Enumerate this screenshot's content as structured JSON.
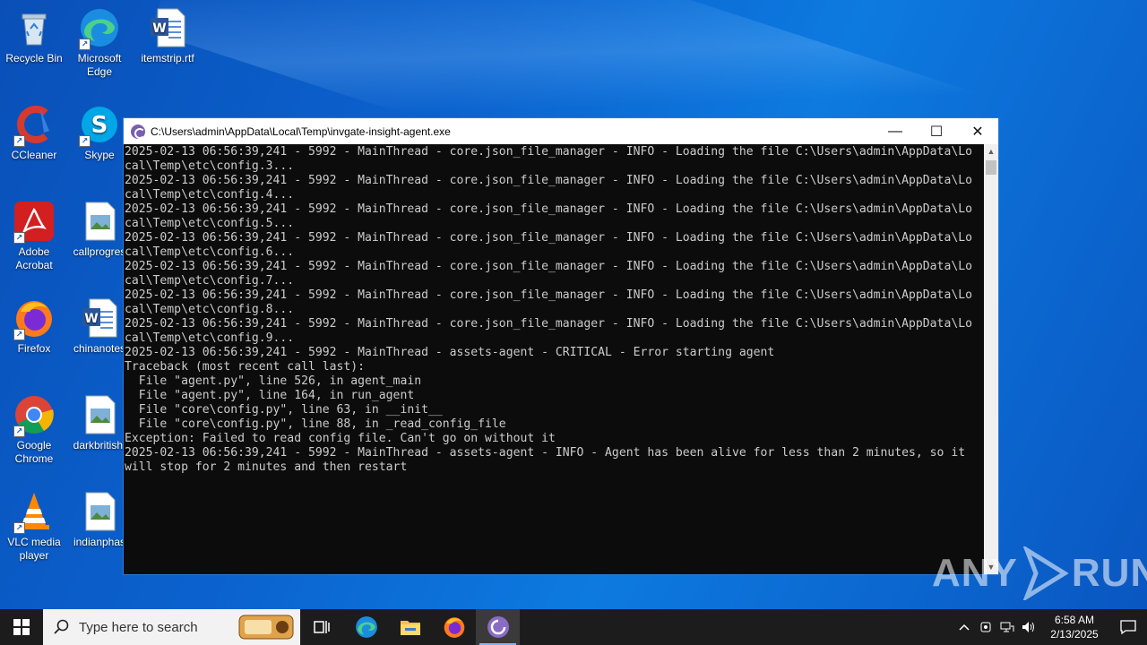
{
  "desktop": {
    "icons": [
      {
        "label": "Recycle Bin"
      },
      {
        "label": "Microsoft Edge"
      },
      {
        "label": "itemstrip.rtf"
      },
      {
        "label": "CCleaner"
      },
      {
        "label": "Skype"
      },
      {
        "label": "Adobe Acrobat"
      },
      {
        "label": "callprogres"
      },
      {
        "label": "Firefox"
      },
      {
        "label": "chinanotes"
      },
      {
        "label": "Google Chrome"
      },
      {
        "label": "darkbritish."
      },
      {
        "label": "VLC media player"
      },
      {
        "label": "indianphas"
      }
    ]
  },
  "window": {
    "title": "C:\\Users\\admin\\AppData\\Local\\Temp\\invgate-insight-agent.exe",
    "minimize_glyph": "—",
    "maximize_glyph": "☐",
    "close_glyph": "✕",
    "console_lines": [
      "2025-02-13 06:56:39,241 - 5992 - MainThread - core.json_file_manager - INFO - Loading the file C:\\Users\\admin\\AppData\\Lo",
      "cal\\Temp\\etc\\config.3...",
      "2025-02-13 06:56:39,241 - 5992 - MainThread - core.json_file_manager - INFO - Loading the file C:\\Users\\admin\\AppData\\Lo",
      "cal\\Temp\\etc\\config.4...",
      "2025-02-13 06:56:39,241 - 5992 - MainThread - core.json_file_manager - INFO - Loading the file C:\\Users\\admin\\AppData\\Lo",
      "cal\\Temp\\etc\\config.5...",
      "2025-02-13 06:56:39,241 - 5992 - MainThread - core.json_file_manager - INFO - Loading the file C:\\Users\\admin\\AppData\\Lo",
      "cal\\Temp\\etc\\config.6...",
      "2025-02-13 06:56:39,241 - 5992 - MainThread - core.json_file_manager - INFO - Loading the file C:\\Users\\admin\\AppData\\Lo",
      "cal\\Temp\\etc\\config.7...",
      "2025-02-13 06:56:39,241 - 5992 - MainThread - core.json_file_manager - INFO - Loading the file C:\\Users\\admin\\AppData\\Lo",
      "cal\\Temp\\etc\\config.8...",
      "2025-02-13 06:56:39,241 - 5992 - MainThread - core.json_file_manager - INFO - Loading the file C:\\Users\\admin\\AppData\\Lo",
      "cal\\Temp\\etc\\config.9...",
      "2025-02-13 06:56:39,241 - 5992 - MainThread - assets-agent - CRITICAL - Error starting agent",
      "Traceback (most recent call last):",
      "  File \"agent.py\", line 526, in agent_main",
      "  File \"agent.py\", line 164, in run_agent",
      "  File \"core\\config.py\", line 63, in __init__",
      "  File \"core\\config.py\", line 88, in _read_config_file",
      "Exception: Failed to read config file. Can't go on without it",
      "2025-02-13 06:56:39,241 - 5992 - MainThread - assets-agent - INFO - Agent has been alive for less than 2 minutes, so it",
      "will stop for 2 minutes and then restart"
    ]
  },
  "watermark": {
    "left": "ANY",
    "right": "RUN"
  },
  "taskbar": {
    "search_placeholder": "Type here to search",
    "clock_time": "6:58 AM",
    "clock_date": "2/13/2025"
  },
  "colors": {
    "accent": "#0b63cf",
    "console_bg": "#0c0c0c",
    "console_text": "#cccccc",
    "taskbar": "#1c1c1c"
  }
}
